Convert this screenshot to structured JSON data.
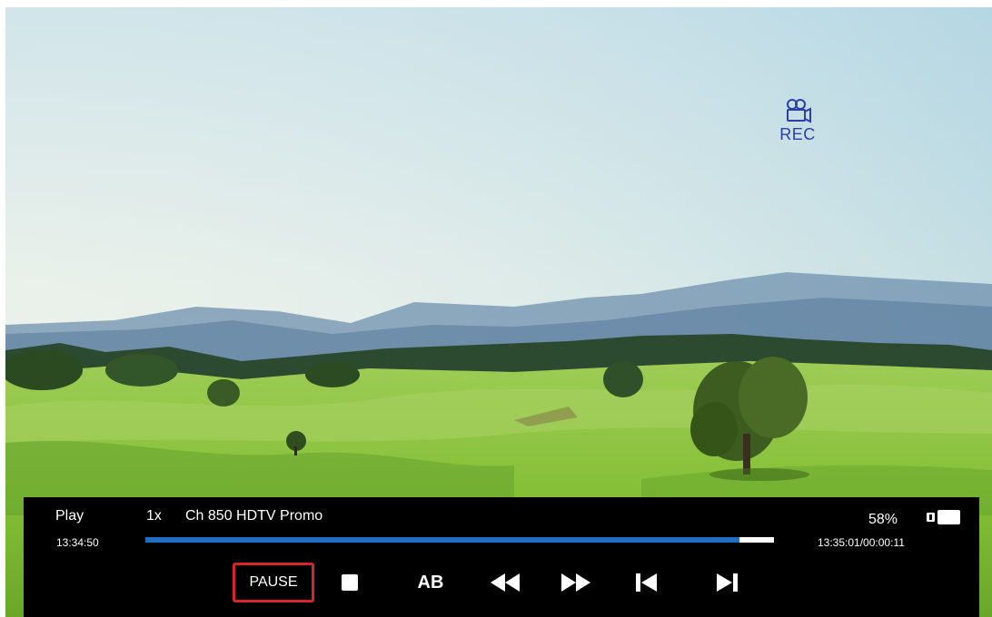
{
  "overlay": {
    "rec_label": "REC",
    "rec_icon": "video-camera-icon",
    "rec_color": "#2a3fa8"
  },
  "osd": {
    "mode": "Play",
    "speed": "1x",
    "channel": "Ch 850 HDTV Promo",
    "start_time": "13:34:50",
    "volume": "58%",
    "end_time": "13:35:01/00:00:11",
    "progress": 0.945,
    "progress_color": "#1f6fc4",
    "battery_icon": "battery-icon"
  },
  "controls": {
    "pause_label": "PAUSE",
    "ab_label": "AB",
    "highlight_color": "#d7262b",
    "icons": [
      "stop-icon",
      "rewind-icon",
      "fast-forward-icon",
      "skip-previous-icon",
      "skip-next-icon"
    ]
  }
}
